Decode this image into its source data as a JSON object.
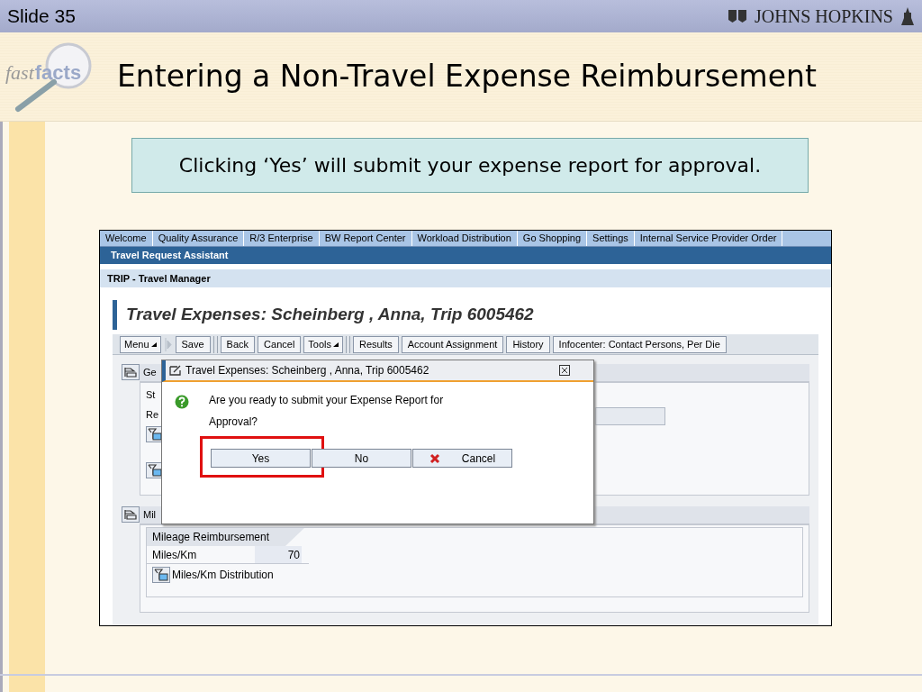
{
  "slide": {
    "number": "Slide 35",
    "brand": "JOHNS HOPKINS",
    "logo": {
      "part_1": "fast",
      "part_2": "facts"
    },
    "title": "Entering a Non-Travel Expense Reimbursement",
    "callout": "Clicking ‘Yes’ will submit your expense report for approval."
  },
  "app": {
    "tabs": [
      {
        "label": "Welcome",
        "selected": false
      },
      {
        "label": "Quality Assurance",
        "selected": false
      },
      {
        "label": "R/3 Enterprise",
        "selected": false
      },
      {
        "label": "BW Report Center",
        "selected": false
      },
      {
        "label": "Workload Distribution",
        "selected": false
      },
      {
        "label": "Go Shopping",
        "selected": false
      },
      {
        "label": "Settings",
        "selected": false
      },
      {
        "label": "Internal Service Provider Order",
        "selected": false
      }
    ],
    "banner": "Travel Request Assistant",
    "breadcrumb": "TRIP - Travel Manager",
    "page_title": "Travel Expenses: Scheinberg , Anna, Trip 6005462",
    "toolbar": [
      {
        "kind": "menu",
        "label": "Menu"
      },
      {
        "kind": "arrow"
      },
      {
        "kind": "button",
        "label": "Save"
      },
      {
        "kind": "divider"
      },
      {
        "kind": "button",
        "label": "Back"
      },
      {
        "kind": "button",
        "label": "Cancel"
      },
      {
        "kind": "menu",
        "label": "Tools"
      },
      {
        "kind": "divider"
      },
      {
        "kind": "button",
        "label": "Results"
      },
      {
        "kind": "button",
        "label": "Account Assignment"
      },
      {
        "kind": "button",
        "label": "History"
      },
      {
        "kind": "button",
        "label": "Infocenter: Contact Persons, Per Die"
      }
    ],
    "general": {
      "heading": "Ge",
      "rows": [
        "St",
        "Re"
      ]
    },
    "mileage": {
      "heading": "Mil",
      "tab": "Mileage Reimbursement",
      "field_label": "Miles/Km",
      "field_value": "70",
      "link": "Miles/Km Distribution"
    },
    "dialog": {
      "title": "Travel Expenses: Scheinberg , Anna, Trip 6005462",
      "message": "Are you ready to submit your Expense Report for Approval?",
      "buttons": [
        {
          "label": "Yes",
          "kind": "plain",
          "highlighted": true
        },
        {
          "label": "No",
          "kind": "plain",
          "highlighted": false
        },
        {
          "label": "Cancel",
          "kind": "cancel",
          "highlighted": false
        }
      ]
    }
  }
}
